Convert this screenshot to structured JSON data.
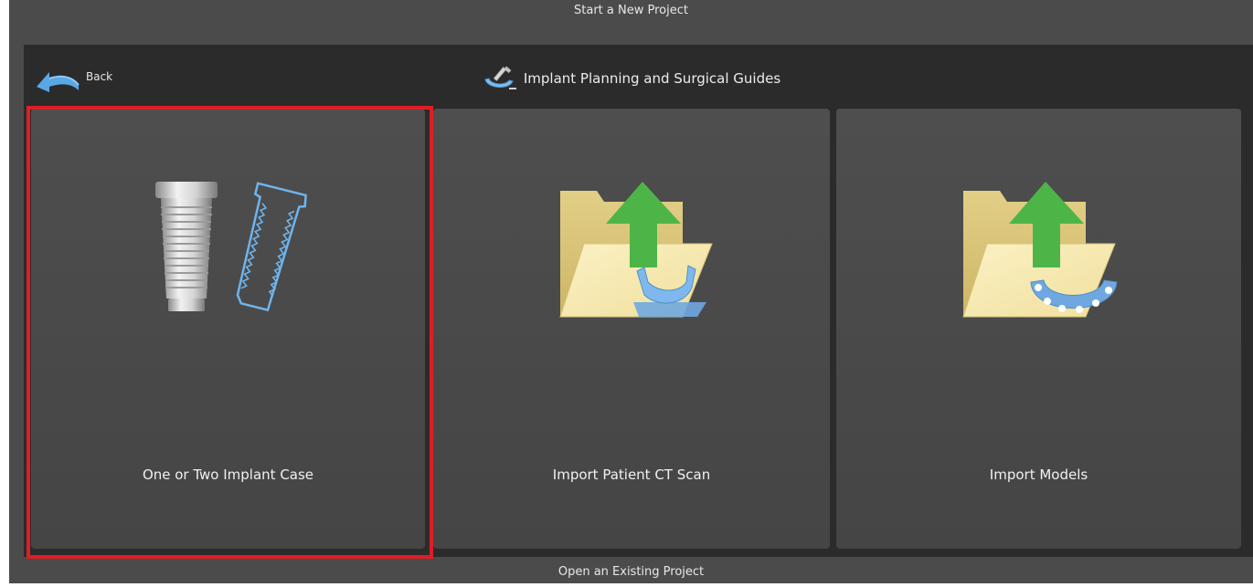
{
  "window": {
    "title": "Start a New Project",
    "footer_link": "Open an Existing Project"
  },
  "header": {
    "back_label": "Back",
    "title": "Implant Planning and Surgical Guides",
    "title_icon": "surgical-guide-icon",
    "back_icon": "back-arrow-icon"
  },
  "tiles": [
    {
      "label": "One or Two Implant Case",
      "icon": "implant-icon",
      "selected": true
    },
    {
      "label": "Import Patient CT Scan",
      "icon": "folder-upload-ct-icon",
      "selected": false
    },
    {
      "label": "Import Models",
      "icon": "folder-upload-models-icon",
      "selected": false
    }
  ],
  "colors": {
    "background": "#4b4b4b",
    "panel": "#2b2b2b",
    "tile": "#4a4a4a",
    "selection": "#e01d24",
    "accent_blue": "#6fb4ec",
    "arrow_green": "#4db548",
    "folder": "#f4e7a8"
  }
}
